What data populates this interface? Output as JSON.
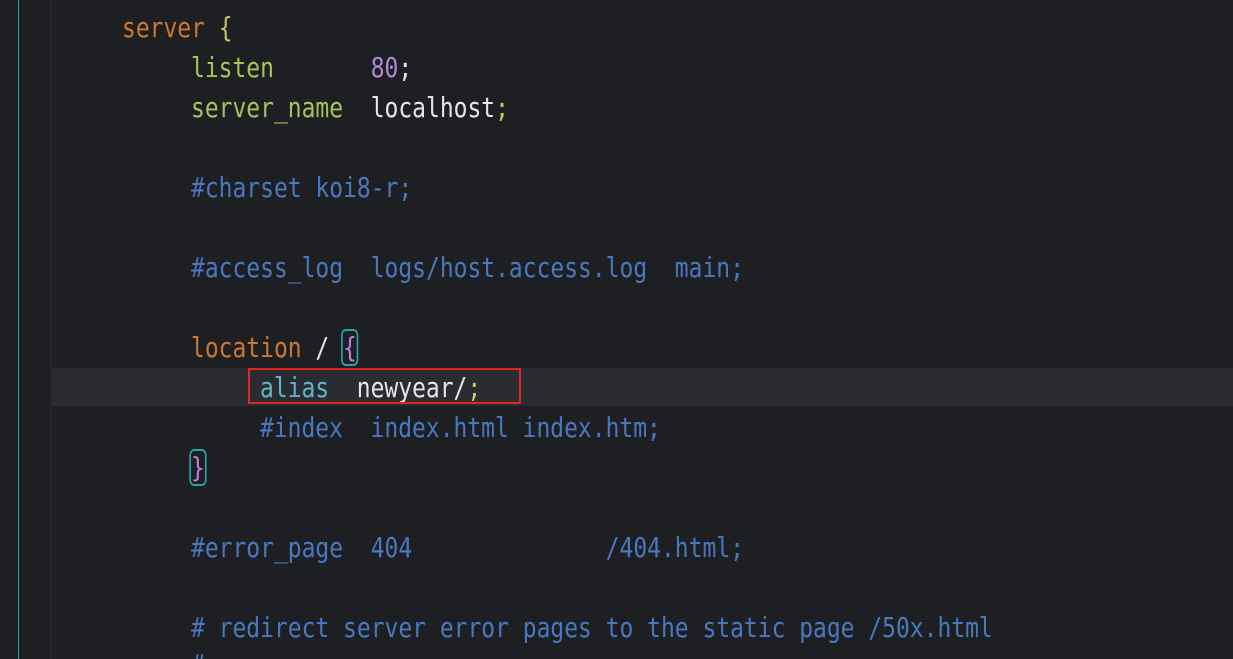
{
  "code": {
    "server_kw": "server",
    "server_brace": "{",
    "listen_kw": "listen",
    "listen_value": "80",
    "server_name_kw": "server_name",
    "server_name_value": "localhost",
    "semicolon": ";",
    "charset_comment": "#charset koi8-r;",
    "access_log_comment": "#access_log  logs/host.access.log  main;",
    "location_kw": "location",
    "location_path": "/",
    "location_brace_open": "{",
    "alias_kw": "alias",
    "alias_value": "newyear/",
    "index_comment": "#index  index.html index.htm;",
    "location_brace_close": "}",
    "error_page_comment": "#error_page  404              /404.html;",
    "redirect_comment": "# redirect server error pages to the static page /50x.html",
    "partial_comment": "#"
  },
  "colors": {
    "background": "#1e1f22",
    "keyword_orange": "#cc7832",
    "keyword_green": "#a5c25c",
    "keyword_teal": "#5fb5c5",
    "number_purple": "#b188d8",
    "comment_blue": "#4a78c0",
    "highlight_box_red": "#e02525",
    "bracket_match": "#2aa3a7"
  }
}
